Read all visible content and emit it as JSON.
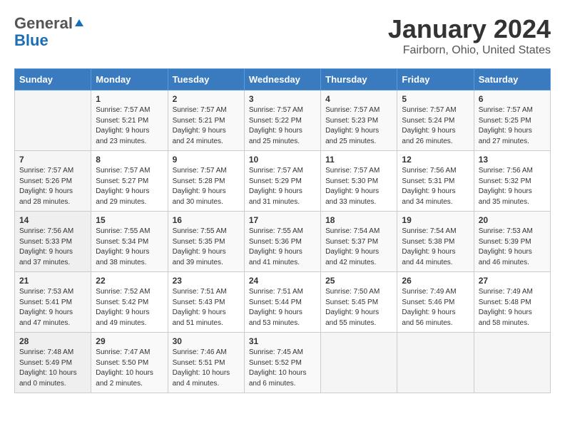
{
  "header": {
    "logo_general": "General",
    "logo_blue": "Blue",
    "title": "January 2024",
    "subtitle": "Fairborn, Ohio, United States"
  },
  "days_of_week": [
    "Sunday",
    "Monday",
    "Tuesday",
    "Wednesday",
    "Thursday",
    "Friday",
    "Saturday"
  ],
  "weeks": [
    [
      {
        "num": "",
        "sunrise": "",
        "sunset": "",
        "daylight": ""
      },
      {
        "num": "1",
        "sunrise": "Sunrise: 7:57 AM",
        "sunset": "Sunset: 5:21 PM",
        "daylight": "Daylight: 9 hours and 23 minutes."
      },
      {
        "num": "2",
        "sunrise": "Sunrise: 7:57 AM",
        "sunset": "Sunset: 5:21 PM",
        "daylight": "Daylight: 9 hours and 24 minutes."
      },
      {
        "num": "3",
        "sunrise": "Sunrise: 7:57 AM",
        "sunset": "Sunset: 5:22 PM",
        "daylight": "Daylight: 9 hours and 25 minutes."
      },
      {
        "num": "4",
        "sunrise": "Sunrise: 7:57 AM",
        "sunset": "Sunset: 5:23 PM",
        "daylight": "Daylight: 9 hours and 25 minutes."
      },
      {
        "num": "5",
        "sunrise": "Sunrise: 7:57 AM",
        "sunset": "Sunset: 5:24 PM",
        "daylight": "Daylight: 9 hours and 26 minutes."
      },
      {
        "num": "6",
        "sunrise": "Sunrise: 7:57 AM",
        "sunset": "Sunset: 5:25 PM",
        "daylight": "Daylight: 9 hours and 27 minutes."
      }
    ],
    [
      {
        "num": "7",
        "sunrise": "Sunrise: 7:57 AM",
        "sunset": "Sunset: 5:26 PM",
        "daylight": "Daylight: 9 hours and 28 minutes."
      },
      {
        "num": "8",
        "sunrise": "Sunrise: 7:57 AM",
        "sunset": "Sunset: 5:27 PM",
        "daylight": "Daylight: 9 hours and 29 minutes."
      },
      {
        "num": "9",
        "sunrise": "Sunrise: 7:57 AM",
        "sunset": "Sunset: 5:28 PM",
        "daylight": "Daylight: 9 hours and 30 minutes."
      },
      {
        "num": "10",
        "sunrise": "Sunrise: 7:57 AM",
        "sunset": "Sunset: 5:29 PM",
        "daylight": "Daylight: 9 hours and 31 minutes."
      },
      {
        "num": "11",
        "sunrise": "Sunrise: 7:57 AM",
        "sunset": "Sunset: 5:30 PM",
        "daylight": "Daylight: 9 hours and 33 minutes."
      },
      {
        "num": "12",
        "sunrise": "Sunrise: 7:56 AM",
        "sunset": "Sunset: 5:31 PM",
        "daylight": "Daylight: 9 hours and 34 minutes."
      },
      {
        "num": "13",
        "sunrise": "Sunrise: 7:56 AM",
        "sunset": "Sunset: 5:32 PM",
        "daylight": "Daylight: 9 hours and 35 minutes."
      }
    ],
    [
      {
        "num": "14",
        "sunrise": "Sunrise: 7:56 AM",
        "sunset": "Sunset: 5:33 PM",
        "daylight": "Daylight: 9 hours and 37 minutes."
      },
      {
        "num": "15",
        "sunrise": "Sunrise: 7:55 AM",
        "sunset": "Sunset: 5:34 PM",
        "daylight": "Daylight: 9 hours and 38 minutes."
      },
      {
        "num": "16",
        "sunrise": "Sunrise: 7:55 AM",
        "sunset": "Sunset: 5:35 PM",
        "daylight": "Daylight: 9 hours and 39 minutes."
      },
      {
        "num": "17",
        "sunrise": "Sunrise: 7:55 AM",
        "sunset": "Sunset: 5:36 PM",
        "daylight": "Daylight: 9 hours and 41 minutes."
      },
      {
        "num": "18",
        "sunrise": "Sunrise: 7:54 AM",
        "sunset": "Sunset: 5:37 PM",
        "daylight": "Daylight: 9 hours and 42 minutes."
      },
      {
        "num": "19",
        "sunrise": "Sunrise: 7:54 AM",
        "sunset": "Sunset: 5:38 PM",
        "daylight": "Daylight: 9 hours and 44 minutes."
      },
      {
        "num": "20",
        "sunrise": "Sunrise: 7:53 AM",
        "sunset": "Sunset: 5:39 PM",
        "daylight": "Daylight: 9 hours and 46 minutes."
      }
    ],
    [
      {
        "num": "21",
        "sunrise": "Sunrise: 7:53 AM",
        "sunset": "Sunset: 5:41 PM",
        "daylight": "Daylight: 9 hours and 47 minutes."
      },
      {
        "num": "22",
        "sunrise": "Sunrise: 7:52 AM",
        "sunset": "Sunset: 5:42 PM",
        "daylight": "Daylight: 9 hours and 49 minutes."
      },
      {
        "num": "23",
        "sunrise": "Sunrise: 7:51 AM",
        "sunset": "Sunset: 5:43 PM",
        "daylight": "Daylight: 9 hours and 51 minutes."
      },
      {
        "num": "24",
        "sunrise": "Sunrise: 7:51 AM",
        "sunset": "Sunset: 5:44 PM",
        "daylight": "Daylight: 9 hours and 53 minutes."
      },
      {
        "num": "25",
        "sunrise": "Sunrise: 7:50 AM",
        "sunset": "Sunset: 5:45 PM",
        "daylight": "Daylight: 9 hours and 55 minutes."
      },
      {
        "num": "26",
        "sunrise": "Sunrise: 7:49 AM",
        "sunset": "Sunset: 5:46 PM",
        "daylight": "Daylight: 9 hours and 56 minutes."
      },
      {
        "num": "27",
        "sunrise": "Sunrise: 7:49 AM",
        "sunset": "Sunset: 5:48 PM",
        "daylight": "Daylight: 9 hours and 58 minutes."
      }
    ],
    [
      {
        "num": "28",
        "sunrise": "Sunrise: 7:48 AM",
        "sunset": "Sunset: 5:49 PM",
        "daylight": "Daylight: 10 hours and 0 minutes."
      },
      {
        "num": "29",
        "sunrise": "Sunrise: 7:47 AM",
        "sunset": "Sunset: 5:50 PM",
        "daylight": "Daylight: 10 hours and 2 minutes."
      },
      {
        "num": "30",
        "sunrise": "Sunrise: 7:46 AM",
        "sunset": "Sunset: 5:51 PM",
        "daylight": "Daylight: 10 hours and 4 minutes."
      },
      {
        "num": "31",
        "sunrise": "Sunrise: 7:45 AM",
        "sunset": "Sunset: 5:52 PM",
        "daylight": "Daylight: 10 hours and 6 minutes."
      },
      {
        "num": "",
        "sunrise": "",
        "sunset": "",
        "daylight": ""
      },
      {
        "num": "",
        "sunrise": "",
        "sunset": "",
        "daylight": ""
      },
      {
        "num": "",
        "sunrise": "",
        "sunset": "",
        "daylight": ""
      }
    ]
  ]
}
